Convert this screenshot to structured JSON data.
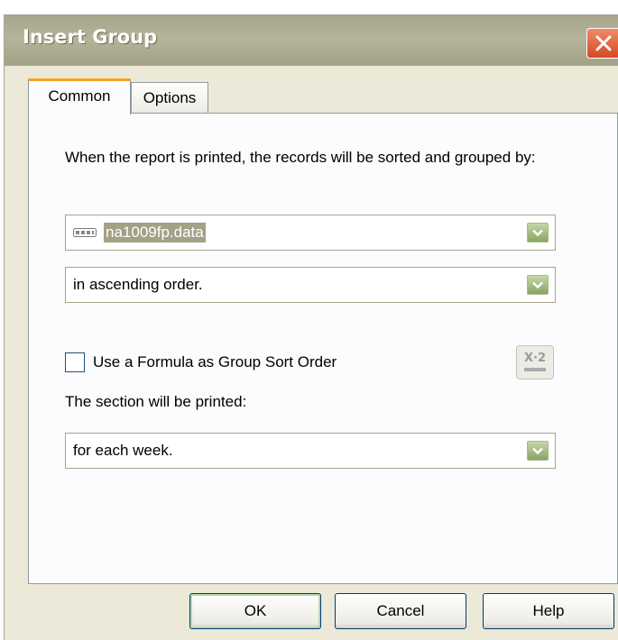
{
  "window": {
    "title": "Insert Group",
    "close_icon": "close-icon"
  },
  "tabs": [
    {
      "label": "Common",
      "active": true
    },
    {
      "label": "Options",
      "active": false
    }
  ],
  "common": {
    "description": "When the report is printed, the records will be sorted and grouped by:",
    "field_combo": {
      "value": "na1009fp.data",
      "icon": "database-field-icon"
    },
    "order_combo": {
      "value": "in ascending order."
    },
    "formula_checkbox": {
      "label": "Use a Formula as Group Sort Order",
      "checked": false
    },
    "formula_button": {
      "icon": "formula-editor-icon",
      "glyph": "X·2"
    },
    "section_label": "The section will be printed:",
    "section_combo": {
      "value": "for each week."
    }
  },
  "buttons": {
    "ok": "OK",
    "cancel": "Cancel",
    "help": "Help"
  },
  "colors": {
    "titlebar": "#a6a48a",
    "dialog_bg": "#ece9d8",
    "active_tab_accent": "#f5a623",
    "close_button": "#e05a30",
    "combo_arrow": "#a8bf86"
  }
}
